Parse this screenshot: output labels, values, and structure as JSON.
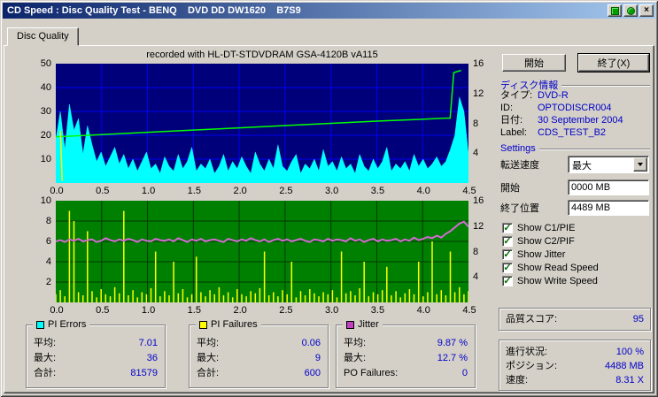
{
  "window": {
    "title": "CD Speed : Disc Quality Test - BENQ    DVD DD DW1620    B7S9"
  },
  "tab": {
    "label": "Disc Quality"
  },
  "chart_header": "recorded with HL-DT-STDVDRAM GSA-4120B vA115",
  "actions": {
    "start": "開始",
    "exit": "終了(X)"
  },
  "disc_info": {
    "header": "ディスク情報",
    "rows": [
      {
        "label": "タイプ:",
        "value": "DVD-R"
      },
      {
        "label": "ID:",
        "value": "OPTODISCR004"
      },
      {
        "label": "日付:",
        "value": "30 September 2004"
      },
      {
        "label": "Label:",
        "value": "CDS_TEST_B2"
      }
    ]
  },
  "settings": {
    "header": "Settings",
    "transfer_speed_label": "転送速度",
    "transfer_speed_value": "最大",
    "start_label": "開始",
    "start_value": "0000 MB",
    "end_label": "終了位置",
    "end_value": "4489 MB",
    "checkboxes": [
      "Show C1/PIE",
      "Show C2/PIF",
      "Show Jitter",
      "Show Read Speed",
      "Show Write Speed"
    ]
  },
  "quality": {
    "label": "品質スコア:",
    "value": "95"
  },
  "progress": [
    {
      "label": "進行状況:",
      "value": "100 %"
    },
    {
      "label": "ポジション:",
      "value": "4488 MB"
    },
    {
      "label": "速度:",
      "value": "8.31 X"
    }
  ],
  "stats": {
    "labels": {
      "avg": "平均:",
      "max": "最大:",
      "total": "合計:"
    },
    "pi_errors": {
      "title": "PI Errors",
      "color": "#00FFFF",
      "avg": "7.01",
      "max": "36",
      "total": "81579"
    },
    "pi_failures": {
      "title": "PI Failures",
      "color": "#FFFF00",
      "avg": "0.06",
      "max": "9",
      "total": "600"
    },
    "jitter": {
      "title": "Jitter",
      "color": "#C040C0",
      "avg": "9.87 %",
      "max": "12.7 %",
      "po_label": "PO Failures:",
      "po_value": "0"
    }
  },
  "chart_data": [
    {
      "type": "area",
      "title": "recorded with HL-DT-STDVDRAM GSA-4120B vA115",
      "x_range": [
        0,
        4.5
      ],
      "x_ticks": [
        "0.0",
        "0.5",
        "1.0",
        "1.5",
        "2.0",
        "2.5",
        "3.0",
        "3.5",
        "4.0",
        "4.5"
      ],
      "left_axis": {
        "range": [
          0,
          50
        ],
        "ticks": [
          50,
          40,
          30,
          20,
          10
        ]
      },
      "right_axis": {
        "range": [
          0,
          16
        ],
        "ticks": [
          16,
          12,
          8,
          4
        ]
      },
      "bg": "#00007B",
      "grid": "#0000F0",
      "series": [
        {
          "name": "pi_errors",
          "style": "area",
          "axis": "left",
          "color": "#00FFFF",
          "values": [
            18,
            30,
            14,
            33,
            22,
            27,
            12,
            24,
            16,
            9,
            13,
            7,
            11,
            15,
            8,
            12,
            6,
            10,
            5,
            9,
            13,
            6,
            8,
            4,
            11,
            7,
            5,
            12,
            6,
            9,
            15,
            5,
            8,
            6,
            10,
            4,
            7,
            12,
            5,
            9,
            6,
            11,
            7,
            4,
            13,
            8,
            5,
            10,
            6,
            16,
            7,
            5,
            9,
            12,
            4,
            8,
            6,
            10,
            5,
            14,
            7,
            9,
            5,
            11,
            6,
            8,
            4,
            12,
            7,
            5,
            10,
            6,
            9,
            15,
            5,
            8,
            6,
            9,
            5,
            12,
            7,
            10,
            6,
            8,
            11,
            7,
            9,
            14,
            20,
            36,
            30,
            12
          ]
        },
        {
          "name": "write_speed",
          "style": "line",
          "axis": "right",
          "color": "#00FF00",
          "width": 1.5,
          "points": [
            [
              0,
              6.2
            ],
            [
              0.5,
              6.5
            ],
            [
              1.0,
              6.8
            ],
            [
              1.5,
              7.1
            ],
            [
              2.0,
              7.4
            ],
            [
              2.5,
              7.7
            ],
            [
              3.0,
              8.0
            ],
            [
              3.5,
              8.3
            ],
            [
              4.0,
              8.55
            ],
            [
              4.25,
              8.7
            ],
            [
              4.3,
              8.7
            ],
            [
              4.34,
              14.8
            ],
            [
              4.42,
              15.1
            ]
          ]
        },
        {
          "name": "read_speed",
          "style": "line",
          "axis": "right",
          "color": "#FFFF00",
          "width": 1.5,
          "points": [
            [
              0.05,
              7.0
            ],
            [
              0.07,
              0.3
            ]
          ]
        }
      ]
    },
    {
      "type": "bar",
      "x_range": [
        0,
        4.5
      ],
      "x_ticks": [
        "0.0",
        "0.5",
        "1.0",
        "1.5",
        "2.0",
        "2.5",
        "3.0",
        "3.5",
        "4.0",
        "4.5"
      ],
      "left_axis": {
        "range": [
          0,
          10
        ],
        "ticks": [
          10,
          8,
          6,
          4,
          2
        ]
      },
      "right_axis": {
        "range": [
          0,
          16
        ],
        "ticks": [
          16,
          12,
          8,
          4
        ]
      },
      "bg": "#008000",
      "grid": "#003800",
      "series": [
        {
          "name": "pi_failures",
          "style": "bars",
          "axis": "left",
          "color": "#FFFF00",
          "values": [
            0.8,
            1.2,
            0.6,
            9,
            8,
            1.0,
            0.7,
            7,
            1.1,
            0.5,
            1.3,
            0.8,
            0.6,
            1.5,
            0.9,
            9,
            0.7,
            1.2,
            0.5,
            1.0,
            0.8,
            1.4,
            5,
            0.6,
            1.1,
            0.7,
            4,
            0.9,
            1.3,
            0.5,
            0.8,
            4.5,
            1.0,
            0.6,
            1.2,
            0.8,
            1.5,
            0.7,
            1.0,
            0.5,
            1.3,
            0.8,
            0.6,
            1.1,
            0.9,
            1.4,
            5,
            0.7,
            1.0,
            0.6,
            1.2,
            0.8,
            4,
            0.5,
            1.1,
            0.7,
            1.3,
            0.9,
            0.6,
            1.0,
            0.8,
            1.2,
            0.5,
            5,
            0.9,
            1.1,
            0.7,
            1.4,
            4,
            0.6,
            1.0,
            0.8,
            1.2,
            3.5,
            0.7,
            1.1,
            0.5,
            0.9,
            1.3,
            0.8,
            4,
            0.6,
            1.0,
            6,
            0.8,
            1.2,
            0.7,
            5,
            1.0,
            1.5,
            0.8,
            1.1
          ]
        },
        {
          "name": "jitter",
          "style": "line",
          "axis": "right",
          "color": "#D36BD3",
          "width": 2,
          "values": [
            9.6,
            9.8,
            9.5,
            9.9,
            9.7,
            10.0,
            9.6,
            9.8,
            9.9,
            9.5,
            9.7,
            10.1,
            9.8,
            9.6,
            9.9,
            9.7,
            10.0,
            9.8,
            9.5,
            9.9,
            9.7,
            9.6,
            10.0,
            9.8,
            9.7,
            9.9,
            9.6,
            10.1,
            9.8,
            9.5,
            9.9,
            9.7,
            10.0,
            9.6,
            9.8,
            9.9,
            9.7,
            9.5,
            10.0,
            9.8,
            9.6,
            9.9,
            9.7,
            10.1,
            9.8,
            9.6,
            9.9,
            9.5,
            9.8,
            10.0,
            9.7,
            9.9,
            9.6,
            9.8,
            10.0,
            9.7,
            9.5,
            9.9,
            9.8,
            9.6,
            10.0,
            9.7,
            9.9,
            9.8,
            9.6,
            10.1,
            9.7,
            9.9,
            9.5,
            9.8,
            10.0,
            9.6,
            9.9,
            9.7,
            9.8,
            10.0,
            9.6,
            9.9,
            9.7,
            10.2,
            9.8,
            10.0,
            10.3,
            10.1,
            10.5,
            10.2,
            10.8,
            11.2,
            11.8,
            12.4,
            12.7,
            11.9
          ]
        }
      ]
    }
  ]
}
